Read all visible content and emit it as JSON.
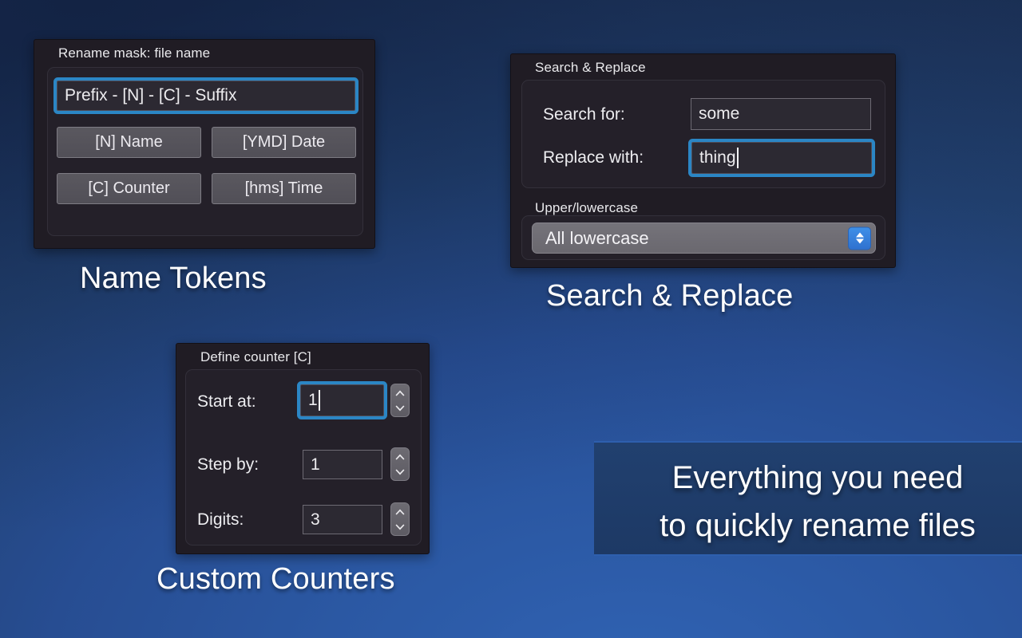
{
  "background": {
    "gradient_from": "#1b3055",
    "gradient_to": "#3063b4"
  },
  "accent": {
    "focus_ring": "#2b86c5",
    "select_button": "#3080e0"
  },
  "panels": {
    "name_tokens": {
      "title": "Rename mask: file name",
      "mask_field": {
        "value": "Prefix - [N] - [C] - Suffix",
        "focused": true
      },
      "buttons": [
        {
          "label": "[N] Name"
        },
        {
          "label": "[YMD] Date"
        },
        {
          "label": "[C] Counter"
        },
        {
          "label": "[hms] Time"
        }
      ],
      "caption": "Name Tokens"
    },
    "search_replace": {
      "title": "Search & Replace",
      "rows": [
        {
          "label": "Search for:",
          "value": "some",
          "focused": false
        },
        {
          "label": "Replace with:",
          "value": "thing",
          "focused": true
        }
      ],
      "case_group_title": "Upper/lowercase",
      "case_select": {
        "value": "All lowercase",
        "icon": "up-down-chevron-icon"
      },
      "caption": "Search & Replace"
    },
    "counters": {
      "title": "Define counter [C]",
      "rows": [
        {
          "label": "Start at:",
          "value": "1",
          "focused": true
        },
        {
          "label": "Step by:",
          "value": "1",
          "focused": false
        },
        {
          "label": "Digits:",
          "value": "3",
          "focused": false
        }
      ],
      "stepper_icon": "stepper-up-down-icon",
      "caption": "Custom Counters"
    }
  },
  "tagline": {
    "line1": "Everything you need",
    "line2": "to quickly rename files"
  }
}
